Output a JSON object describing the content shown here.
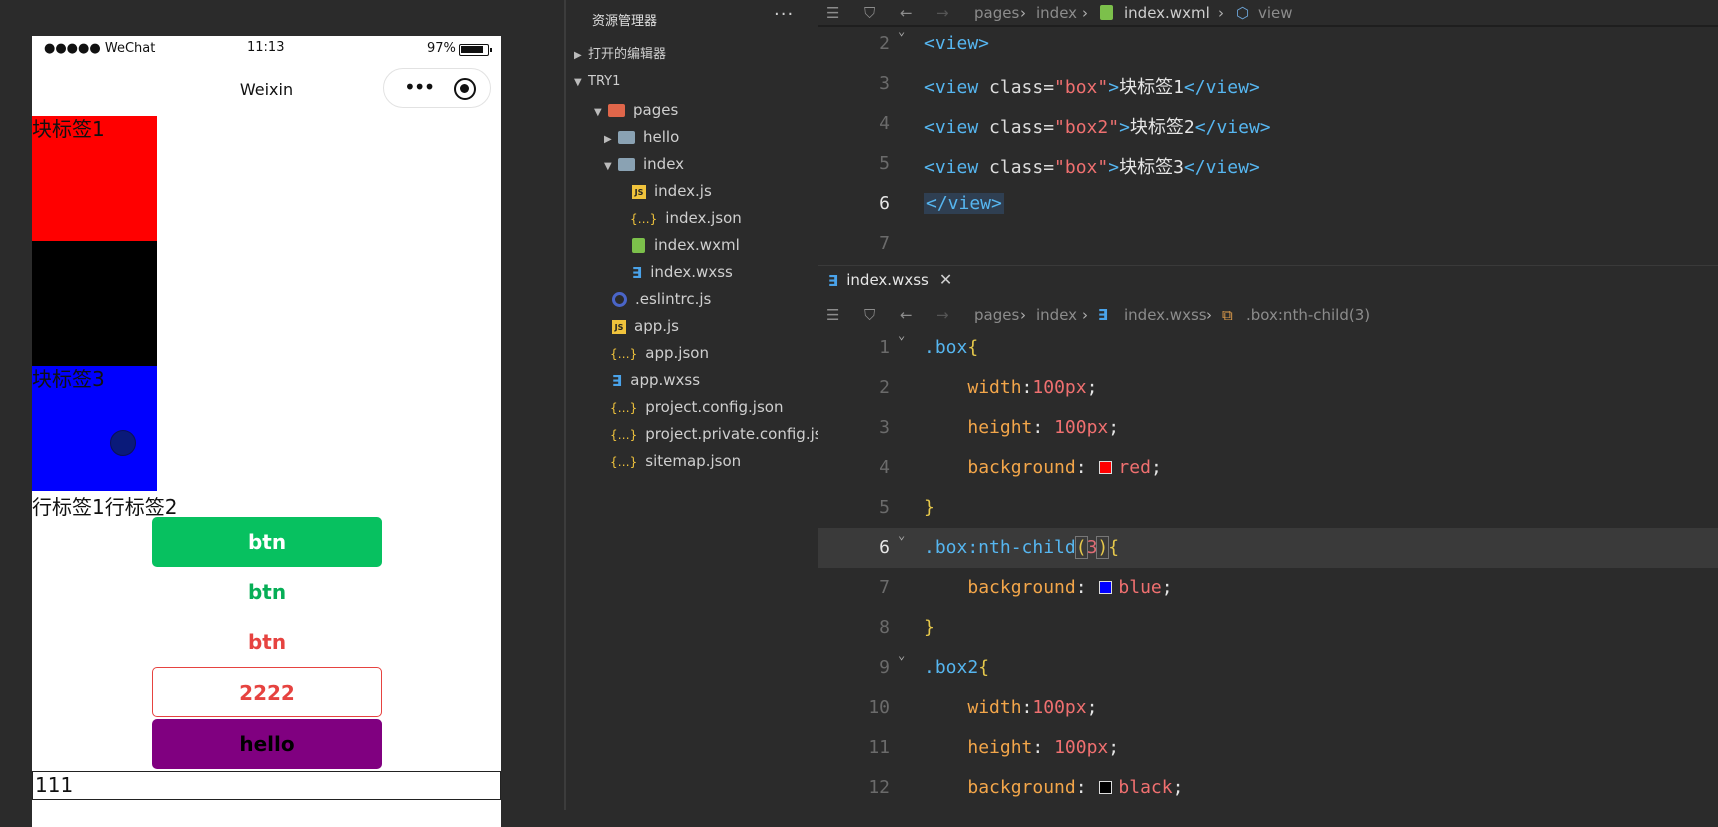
{
  "simulator": {
    "status": {
      "signal": "●●●●● WeChat",
      "time": "11:13",
      "battery": "97%"
    },
    "nav_title": "Weixin",
    "capsule_dots": "•••",
    "blocks": [
      "块标签1",
      "",
      "块标签3"
    ],
    "block_colors": [
      "#ff0000",
      "#000000",
      "#0000ff"
    ],
    "inline_text": "行标签1行标签2",
    "buttons": [
      "btn",
      "btn",
      "btn",
      "2222",
      "hello"
    ],
    "input_value": "111"
  },
  "explorer": {
    "title": "资源管理器",
    "more": "···",
    "open_editors": "打开的编辑器",
    "project": "TRY1",
    "tree": [
      {
        "label": "pages",
        "kind": "folder-pages"
      },
      {
        "label": "hello",
        "kind": "folder"
      },
      {
        "label": "index",
        "kind": "folder"
      },
      {
        "label": "index.js",
        "kind": "js"
      },
      {
        "label": "index.json",
        "kind": "json"
      },
      {
        "label": "index.wxml",
        "kind": "wxml"
      },
      {
        "label": "index.wxss",
        "kind": "wxss"
      },
      {
        "label": ".eslintrc.js",
        "kind": "eslint"
      },
      {
        "label": "app.js",
        "kind": "js"
      },
      {
        "label": "app.json",
        "kind": "json"
      },
      {
        "label": "app.wxss",
        "kind": "wxss"
      },
      {
        "label": "project.config.json",
        "kind": "json"
      },
      {
        "label": "project.private.config.js...",
        "kind": "json"
      },
      {
        "label": "sitemap.json",
        "kind": "json"
      }
    ]
  },
  "editor_top": {
    "breadcrumb": [
      "pages",
      "index",
      "index.wxml",
      "view"
    ],
    "lines": [
      "2",
      "3",
      "4",
      "5",
      "6",
      "7"
    ],
    "code": {
      "l2": "<view>",
      "open": "<view",
      "class_attr": " class=",
      "box": "\"box\"",
      "box2": "\"box2\"",
      "t1": "块标签1",
      "t2": "块标签2",
      "t3": "块标签3",
      "close": "</view>",
      "gt": ">"
    }
  },
  "editor_bottom": {
    "tab": "index.wxss",
    "tab_close": "✕",
    "breadcrumb": [
      "pages",
      "index",
      "index.wxss",
      ".box:nth-child(3)"
    ],
    "lines": [
      "1",
      "2",
      "3",
      "4",
      "5",
      "6",
      "7",
      "8",
      "9",
      "10",
      "11",
      "12"
    ],
    "code": {
      "sel_box": ".box",
      "sel_nth": ".box:nth-child",
      "nth_arg": "3",
      "sel_box2": ".box2",
      "width_p": "width",
      "width_v": "100px",
      "height_p": "height",
      "height_v": " 100px",
      "bg_p": "background",
      "red": "red",
      "blue": "blue",
      "black": "black"
    }
  }
}
